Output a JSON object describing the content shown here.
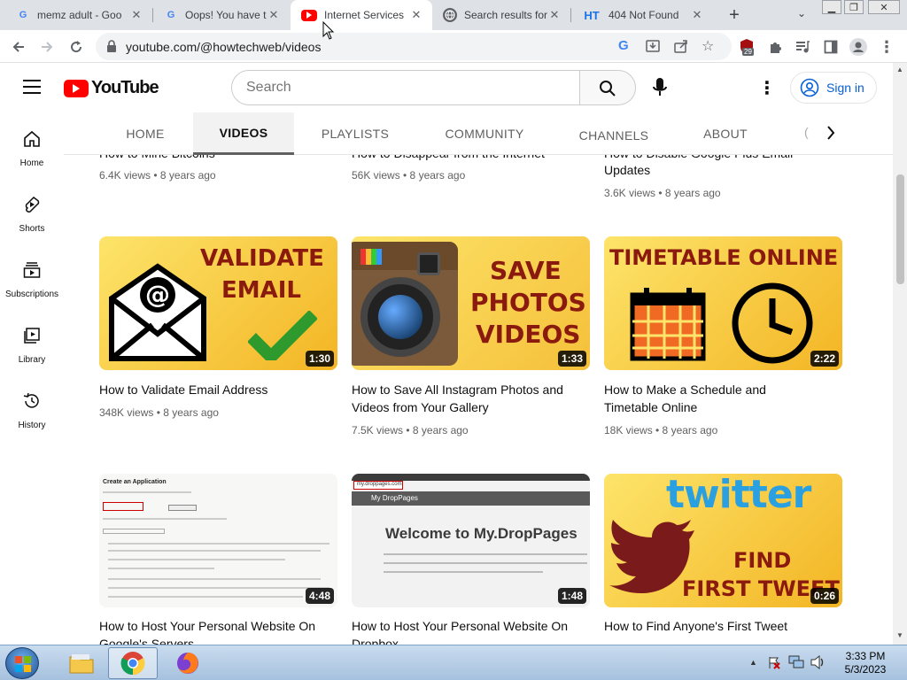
{
  "browser": {
    "tabs": [
      {
        "title": "memz adult - Goo",
        "favicon": "google-g"
      },
      {
        "title": "Oops! You have tr",
        "favicon": "google-g"
      },
      {
        "title": "Internet Services",
        "favicon": "youtube"
      },
      {
        "title": "Search results for",
        "favicon": "globe"
      },
      {
        "title": "404 Not Found",
        "favicon": "ht"
      }
    ],
    "favicon_ht": "HT",
    "new_tab": "+",
    "url": "youtube.com/@howtechweb/videos",
    "extension_badge": "29"
  },
  "youtube": {
    "logo_text": "YouTube",
    "search_placeholder": "Search",
    "signin_label": "Sign in",
    "sidebar": [
      {
        "label": "Home",
        "icon": "home-icon"
      },
      {
        "label": "Shorts",
        "icon": "shorts-icon"
      },
      {
        "label": "Subscriptions",
        "icon": "subscriptions-icon"
      },
      {
        "label": "Library",
        "icon": "library-icon"
      },
      {
        "label": "History",
        "icon": "history-icon"
      }
    ],
    "channel_tabs": [
      "HOME",
      "VIDEOS",
      "PLAYLISTS",
      "COMMUNITY",
      "CHANNELS",
      "ABOUT"
    ],
    "active_tab": "VIDEOS",
    "top_row": [
      {
        "title": "How to Mine Bitcoins",
        "meta": "6.4K views • 8 years ago"
      },
      {
        "title": "How to Disappear from the Internet",
        "meta": "56K views • 8 years ago"
      },
      {
        "title_line1": "How to Disable Google Plus Email",
        "title_line2": "Updates",
        "meta": "3.6K views • 8 years ago"
      }
    ],
    "videos_row1": [
      {
        "title": "How to Validate Email Address",
        "meta": "348K views • 8 years ago",
        "duration": "1:30",
        "thumb_text1": "VALIDATE",
        "thumb_text2": "EMAIL"
      },
      {
        "title_line1": "How to Save All Instagram Photos and",
        "title_line2": "Videos from Your Gallery",
        "meta": "7.5K views • 8 years ago",
        "duration": "1:33",
        "thumb_text1": "SAVE",
        "thumb_text2": "PHOTOS",
        "thumb_text3": "VIDEOS"
      },
      {
        "title_line1": "How to Make a Schedule and",
        "title_line2": "Timetable Online",
        "meta": "18K views • 8 years ago",
        "duration": "2:22",
        "thumb_text1": "TIMETABLE ONLINE"
      }
    ],
    "videos_row2": [
      {
        "title_line1": "How to Host Your Personal Website On",
        "title_line2": "Google's Servers",
        "duration": "4:48",
        "thumb_heading": "Create an Application"
      },
      {
        "title_line1": "How to Host Your Personal Website On",
        "title_line2": "Dropbox",
        "duration": "1:48",
        "thumb_url": "my.droppages.com",
        "thumb_heading": "Welcome to My.DropPages",
        "thumb_nav": "My DropPages"
      },
      {
        "title": "How to Find Anyone's First Tweet",
        "duration": "0:26",
        "thumb_text1": "twitter",
        "thumb_text2": "FIND",
        "thumb_text3": "FIRST TWEET"
      }
    ]
  },
  "taskbar": {
    "time": "3:33 PM",
    "date": "5/3/2023"
  },
  "colors": {
    "youtube_red": "#ff0000",
    "link_blue": "#065fd4",
    "thumb_yellow": "#f7c531",
    "thumb_text": "#8b1a0e"
  }
}
